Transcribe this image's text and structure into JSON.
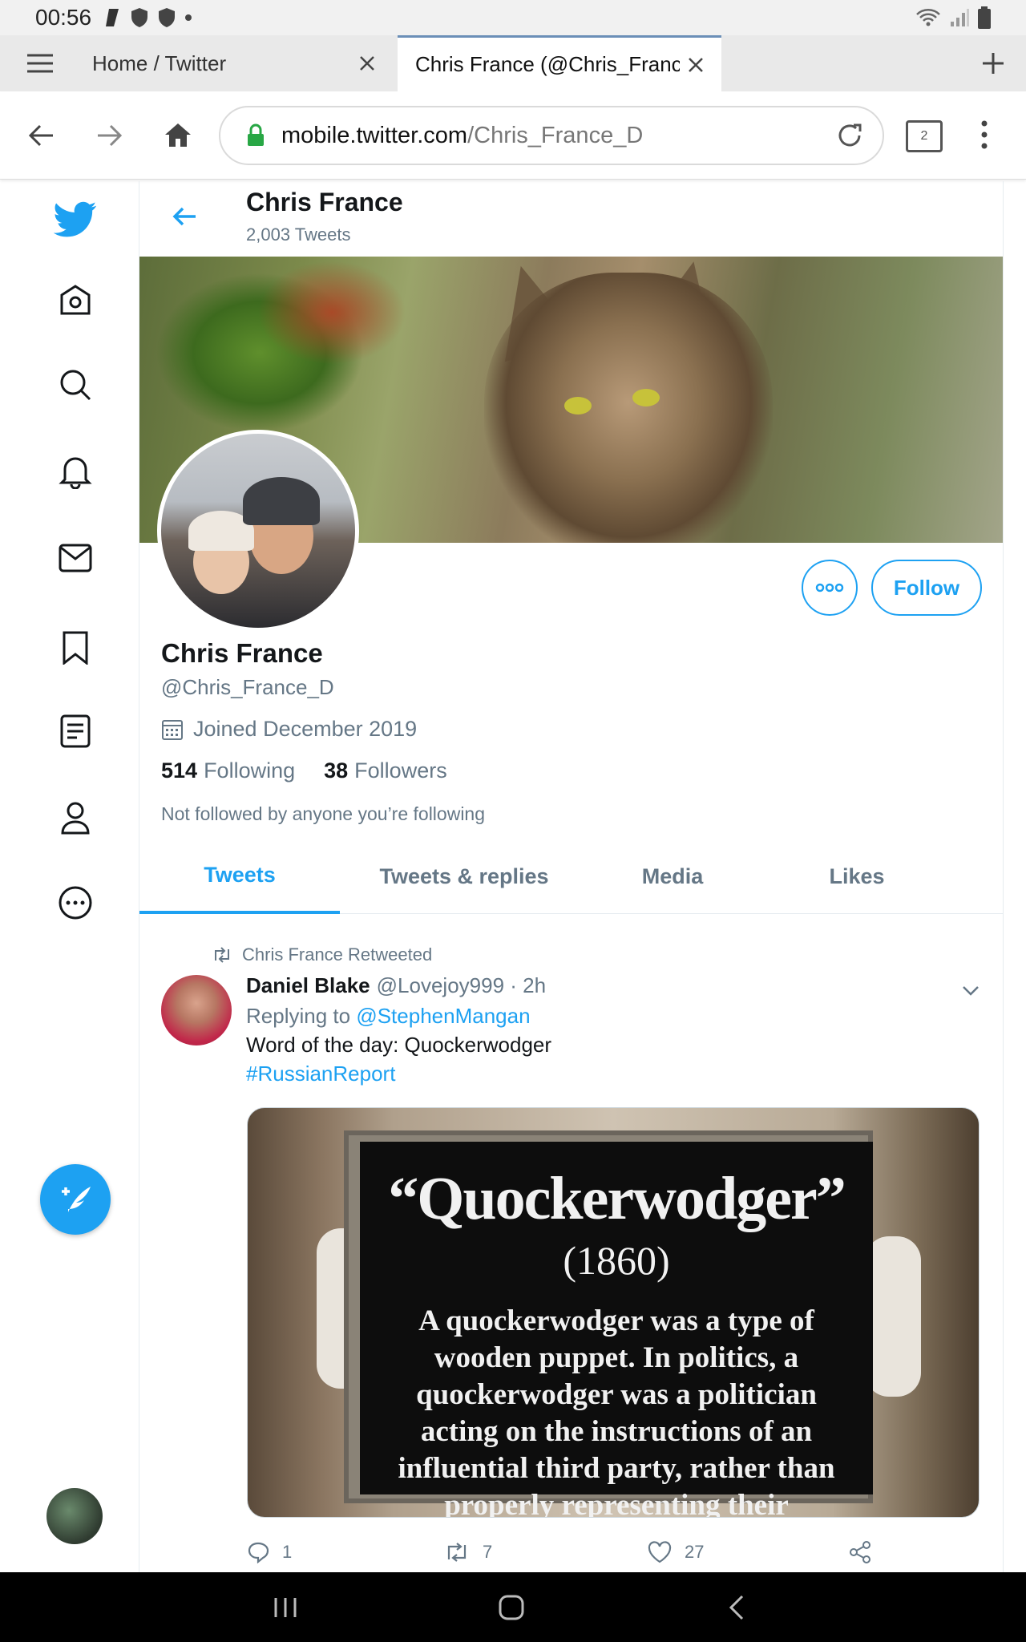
{
  "status_bar": {
    "time": "00:56",
    "icons": [
      "app-icon",
      "shield-icon",
      "shield-icon",
      "dot-icon"
    ],
    "right_icons": [
      "wifi-icon",
      "signal-icon",
      "battery-icon"
    ]
  },
  "browser": {
    "tabs": [
      {
        "title": "Home / Twitter",
        "active": false
      },
      {
        "title": "Chris France (@Chris_Franc",
        "active": true
      }
    ],
    "url_host": "mobile.twitter.com",
    "url_path": "/Chris_France_D",
    "tab_count": "2"
  },
  "sidenav": {
    "items": [
      "home-icon",
      "explore-icon",
      "notifications-icon",
      "messages-icon",
      "bookmarks-icon",
      "lists-icon",
      "profile-icon",
      "more-icon"
    ]
  },
  "profile": {
    "header_name": "Chris France",
    "tweet_count": "2,003 Tweets",
    "name": "Chris France",
    "handle": "@Chris_France_D",
    "joined": "Joined December 2019",
    "following_count": "514",
    "following_label": "Following",
    "followers_count": "38",
    "followers_label": "Followers",
    "not_followed": "Not followed by anyone you’re following",
    "follow_label": "Follow"
  },
  "profile_tabs": [
    {
      "label": "Tweets",
      "active": true
    },
    {
      "label": "Tweets & replies",
      "active": false
    },
    {
      "label": "Media",
      "active": false
    },
    {
      "label": "Likes",
      "active": false
    }
  ],
  "tweet": {
    "retweet_context": "Chris France Retweeted",
    "author_name": "Daniel Blake",
    "author_handle": "@Lovejoy999",
    "time": "· 2h",
    "replying_prefix": "Replying to",
    "replying_to": "@StephenMangan",
    "text": "Word of the day: Quockerwodger",
    "hashtag": "#RussianReport",
    "image_word": "“Quockerwodger”",
    "image_year": "(1860)",
    "image_definition": "A quockerwodger was a type of wooden puppet. In politics, a quockerwodger was a politician acting on the instructions of an influential third party, rather than properly representing their constituents",
    "reply_count": "1",
    "retweet_count": "7",
    "like_count": "27"
  },
  "colors": {
    "accent": "#1da1f2",
    "secondary_text": "#657786",
    "primary_text": "#14171a"
  }
}
